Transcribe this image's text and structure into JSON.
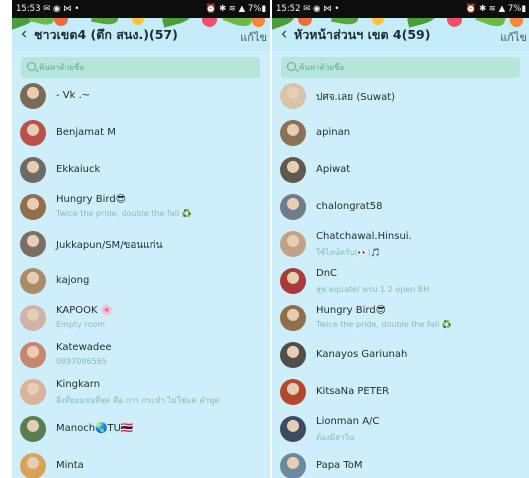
{
  "left": {
    "status_bar": {
      "time_icons": "15:53 ✉ ◉ ⋈ •",
      "system_icons": "⏰ ✱ ≋ ▲ 7%▮"
    },
    "header": {
      "title": "ชาวเขต4 (ตึก สนง.)(57)",
      "edit_label": "แก้ไข"
    },
    "search": {
      "placeholder": "ค้นหาด้วยชื่อ"
    },
    "members": [
      {
        "name": "- Vk .~",
        "status": "",
        "avatar_color": "#7b6a55"
      },
      {
        "name": "Benjamat M",
        "status": "",
        "avatar_color": "#b7514a"
      },
      {
        "name": "Ekkaiuck",
        "status": "",
        "avatar_color": "#6e6a67"
      },
      {
        "name": "Hungry Bird😎",
        "status": "Twice the pride, double the fall ♻️",
        "avatar_color": "#8f6f4c"
      },
      {
        "name": "Jukkapun/SM/ขอนแก่น",
        "status": "",
        "avatar_color": "#7a6f63"
      },
      {
        "name": "kajong",
        "status": "",
        "avatar_color": "#a88d6a"
      },
      {
        "name": "KAPOOK 🌸",
        "status": "Empty room",
        "avatar_color": "#cfb4a8"
      },
      {
        "name": "Katewadee",
        "status": "0897096565",
        "avatar_color": "#c6876d"
      },
      {
        "name": "Kingkarn",
        "status": "สิ่งที่ยอมจนที่สุด คือ การ กระทำ ไม่ใช่แค่ คำพูด",
        "avatar_color": "#d9b39a"
      },
      {
        "name": "Manoch🌏TU🇹🇭",
        "status": "",
        "avatar_color": "#5b7d52"
      },
      {
        "name": "Minta",
        "status": "",
        "avatar_color": "#d9a25a"
      }
    ]
  },
  "right": {
    "status_bar": {
      "time_icons": "15:52 ✉ ◉ ⋈ •",
      "system_icons": "⏰ ✱ ≋ ▲ 7%▮"
    },
    "header": {
      "title": "หัวหน้าส่วนฯ เขต 4(59)",
      "edit_label": "แก้ไข"
    },
    "search": {
      "placeholder": "ค้นหาด้วยชื่อ"
    },
    "members": [
      {
        "name": "ปศจ.เลย (Suwat)",
        "status": "",
        "avatar_color": "#d8c2a8"
      },
      {
        "name": "apinan",
        "status": "",
        "avatar_color": "#8a7256"
      },
      {
        "name": "Apiwat",
        "status": "",
        "avatar_color": "#5f5a4f"
      },
      {
        "name": "chalongrat58",
        "status": "",
        "avatar_color": "#6f7c8a"
      },
      {
        "name": "Chatchawal.Hinsui.",
        "status": "ใช้ไลน์ครับ(👀)🎵",
        "avatar_color": "#c2a286"
      },
      {
        "name": "DnC",
        "status": "สุข equater ครบ 1 2 open BH",
        "avatar_color": "#a83a3a"
      },
      {
        "name": "Hungry Bird😎",
        "status": "Twice the pride, double the fall ♻️",
        "avatar_color": "#8f6f4c"
      },
      {
        "name": "Kanayos Gariunah",
        "status": "",
        "avatar_color": "#4f4e48"
      },
      {
        "name": "KitsaNa PETER",
        "status": "",
        "avatar_color": "#b2482c"
      },
      {
        "name": "Lionman A/C",
        "status": "ต้องมีสาวิน",
        "avatar_color": "#3e4a63"
      },
      {
        "name": "Papa ToM",
        "status": "",
        "avatar_color": "#6a8aa0"
      }
    ]
  }
}
